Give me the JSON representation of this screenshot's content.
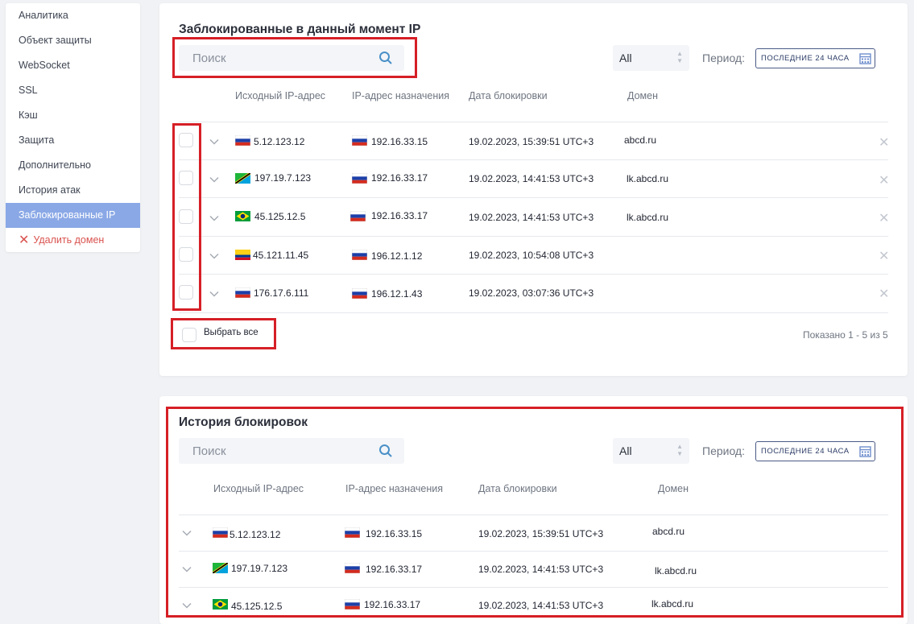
{
  "sidebar": {
    "items": [
      {
        "label": "Аналитика"
      },
      {
        "label": "Объект защиты"
      },
      {
        "label": "WebSocket"
      },
      {
        "label": "SSL"
      },
      {
        "label": "Кэш"
      },
      {
        "label": "Защита"
      },
      {
        "label": "Дополнительно"
      },
      {
        "label": "История атак"
      },
      {
        "label": "Заблокированные IP"
      }
    ],
    "active_index": 8,
    "delete_label": "Удалить домен"
  },
  "blocked": {
    "title": "Заблокированные в данный момент IP",
    "search_placeholder": "Поиск",
    "filter_value": "All",
    "period_label": "Период:",
    "period_value": "ПОСЛЕДНИЕ 24 ЧАСА",
    "columns": [
      "Исходный IP-адрес",
      "IP-адрес назначения",
      "Дата блокировки",
      "Домен"
    ],
    "rows": [
      {
        "src_flag": "ru",
        "src": "5.12.123.12",
        "dst_flag": "ru",
        "dst": "192.16.33.15",
        "date": "19.02.2023, 15:39:51 UTC+3",
        "domain": "abcd.ru"
      },
      {
        "src_flag": "tz",
        "src": "197.19.7.123",
        "dst_flag": "ru",
        "dst": "192.16.33.17",
        "date": "19.02.2023, 14:41:53 UTC+3",
        "domain": "lk.abcd.ru"
      },
      {
        "src_flag": "br",
        "src": "45.125.12.5",
        "dst_flag": "ru",
        "dst": "192.16.33.17",
        "date": "19.02.2023, 14:41:53 UTC+3",
        "domain": "lk.abcd.ru"
      },
      {
        "src_flag": "co",
        "src": "45.121.11.45",
        "dst_flag": "ru",
        "dst": "196.12.1.12",
        "date": "19.02.2023, 10:54:08 UTC+3",
        "domain": ""
      },
      {
        "src_flag": "ru",
        "src": "176.17.6.111",
        "dst_flag": "ru",
        "dst": "196.12.1.43",
        "date": "19.02.2023, 03:07:36 UTC+3",
        "domain": ""
      }
    ],
    "select_all_label": "Выбрать все",
    "shown_text": "Показано 1 - 5 из 5"
  },
  "history": {
    "title": "История блокировок",
    "search_placeholder": "Поиск",
    "filter_value": "All",
    "period_label": "Период:",
    "period_value": "ПОСЛЕДНИЕ 24 ЧАСА",
    "columns": [
      "Исходный IP-адрес",
      "IP-адрес назначения",
      "Дата блокировки",
      "Домен"
    ],
    "rows": [
      {
        "src_flag": "ru",
        "src": "5.12.123.12",
        "dst_flag": "ru",
        "dst": "192.16.33.15",
        "date": "19.02.2023, 15:39:51 UTC+3",
        "domain": "abcd.ru"
      },
      {
        "src_flag": "tz",
        "src": "197.19.7.123",
        "dst_flag": "ru",
        "dst": "192.16.33.17",
        "date": "19.02.2023, 14:41:53 UTC+3",
        "domain": "lk.abcd.ru"
      },
      {
        "src_flag": "br",
        "src": "45.125.12.5",
        "dst_flag": "ru",
        "dst": "192.16.33.17",
        "date": "19.02.2023, 14:41:53 UTC+3",
        "domain": "lk.abcd.ru"
      }
    ]
  },
  "colors": {
    "accent": "#8aa8e6",
    "danger": "#d9534f",
    "highlight_red": "#d61f26"
  }
}
